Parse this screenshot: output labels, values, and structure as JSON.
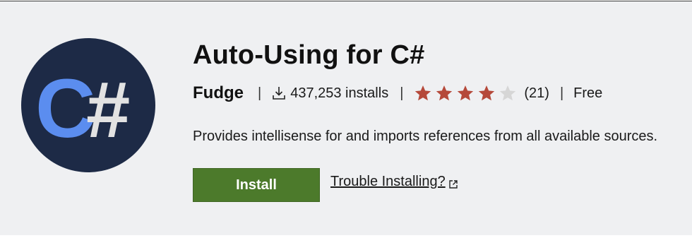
{
  "extension": {
    "logo_text": "C#",
    "title": "Auto-Using for C#",
    "publisher": "Fudge",
    "install_count": "437,253 installs",
    "rating": {
      "stars_filled": 4,
      "stars_total": 5,
      "count": "(21)"
    },
    "price": "Free",
    "description": "Provides intellisense for and imports references from all available sources.",
    "install_label": "Install",
    "trouble_label": "Trouble Installing?"
  },
  "separators": {
    "bar": "|"
  },
  "icons": {
    "download": "download-icon",
    "star": "star-icon",
    "external_link": "external-link-icon"
  },
  "colors": {
    "banner_bg": "#eff0f2",
    "logo_bg": "#1d2a46",
    "logo_c": "#5b8def",
    "logo_hash": "#e2e2e2",
    "star_filled": "#b5493a",
    "star_empty": "#d6d6d6",
    "install_bg": "#4c7a2b"
  }
}
